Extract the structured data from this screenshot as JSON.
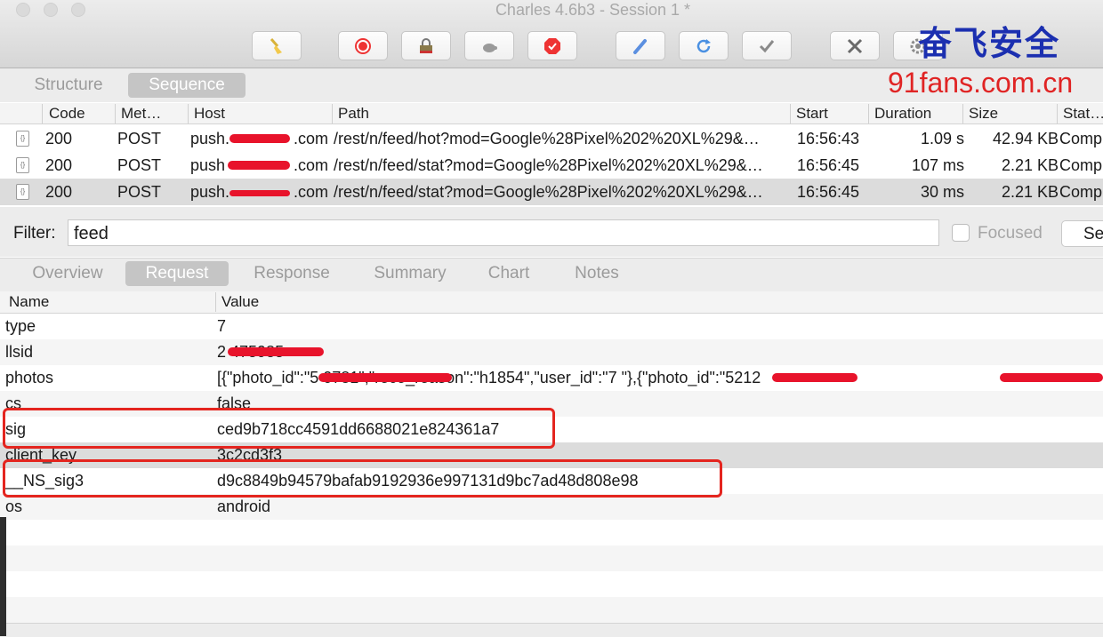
{
  "window": {
    "title": "Charles 4.6b3 - Session 1 *"
  },
  "toolbar": {
    "buttons": [
      {
        "name": "broom-icon",
        "icon": "broom"
      },
      {
        "name": "record-icon",
        "icon": "record"
      },
      {
        "name": "ssl-proxy-icon",
        "icon": "lock"
      },
      {
        "name": "throttle-icon",
        "icon": "turtle"
      },
      {
        "name": "breakpoints-icon",
        "icon": "stop"
      },
      {
        "name": "compose-icon",
        "icon": "pen"
      },
      {
        "name": "repeat-icon",
        "icon": "refresh"
      },
      {
        "name": "validate-icon",
        "icon": "check"
      },
      {
        "name": "tools-icon",
        "icon": "tools"
      },
      {
        "name": "settings-icon",
        "icon": "gear"
      }
    ]
  },
  "watermark": {
    "cn": "奋飞安全",
    "url": "91fans.com.cn"
  },
  "top_tabs": [
    "Structure",
    "Sequence"
  ],
  "sessions": {
    "columns": [
      "Code",
      "Met…",
      "Host",
      "Path",
      "Start",
      "Duration",
      "Size",
      "Stat…"
    ],
    "rows": [
      {
        "code": "200",
        "method": "POST",
        "host_a": "push.",
        "host_b": ".com",
        "path": "/rest/n/feed/hot?mod=Google%28Pixel%202%20XL%29&…",
        "start": "16:56:43",
        "duration": "1.09 s",
        "size": "42.94 KB",
        "status": "Comp"
      },
      {
        "code": "200",
        "method": "POST",
        "host_a": "push",
        "host_b": ".com",
        "path": "/rest/n/feed/stat?mod=Google%28Pixel%202%20XL%29&…",
        "start": "16:56:45",
        "duration": "107 ms",
        "size": "2.21 KB",
        "status": "Comp"
      },
      {
        "code": "200",
        "method": "POST",
        "host_a": "push.",
        "host_b": ".com",
        "path": "/rest/n/feed/stat?mod=Google%28Pixel%202%20XL%29&…",
        "start": "16:56:45",
        "duration": "30 ms",
        "size": "2.21 KB",
        "status": "Comp"
      }
    ]
  },
  "filter": {
    "label": "Filter:",
    "value": "feed",
    "focused_label": "Focused",
    "settings_label": "Se"
  },
  "detail_tabs": [
    "Overview",
    "Request",
    "Response",
    "Summary",
    "Chart",
    "Notes"
  ],
  "params": {
    "columns": [
      "Name",
      "Value"
    ],
    "rows": [
      {
        "name": "type",
        "value": "7"
      },
      {
        "name": "llsid",
        "value": "2          475985"
      },
      {
        "name": "photos",
        "value": "[{\"photo_id\":\"5                0781\",\"reco_reason\":\"h1854\",\"user_id\":\"7          \"},{\"photo_id\":\"5212"
      },
      {
        "name": "cs",
        "value": "false"
      },
      {
        "name": "sig",
        "value": "ced9b718cc4591dd6688021e824361a7"
      },
      {
        "name": "client_key",
        "value": "3c2cd3f3"
      },
      {
        "name": "__NS_sig3",
        "value": "d9c8849b94579bafab9192936e997131d9bc7ad48d808e98"
      },
      {
        "name": "os",
        "value": "android"
      }
    ]
  },
  "colors": {
    "highlight": "#e4251f",
    "redaction": "#e8132b",
    "watermark_blue": "#1b2fb0",
    "watermark_red": "#e02424"
  }
}
